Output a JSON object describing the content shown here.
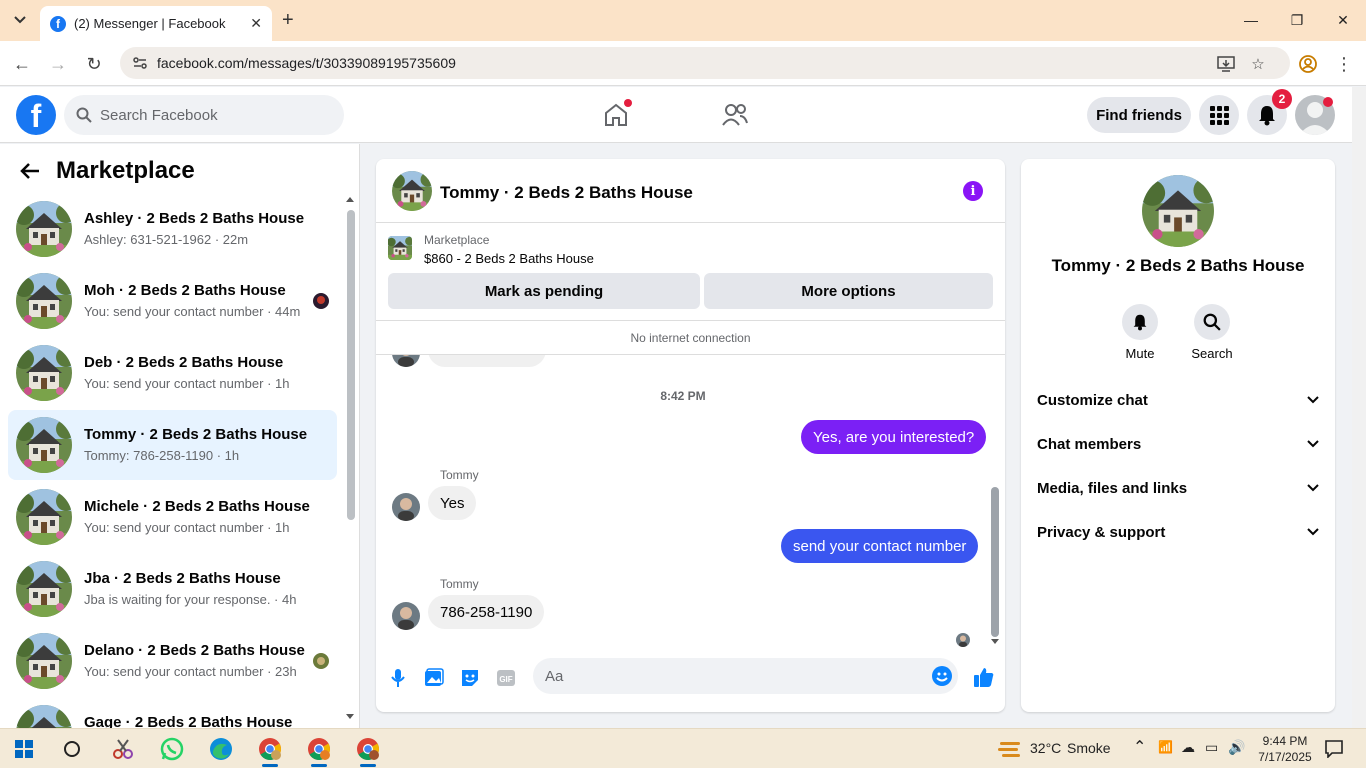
{
  "browser": {
    "tab_title": "(2) Messenger | Facebook",
    "url": "facebook.com/messages/t/30339089195735609"
  },
  "fb_header": {
    "search_placeholder": "Search Facebook",
    "find_friends": "Find friends",
    "notifications_badge": "2"
  },
  "sidebar": {
    "title": "Marketplace",
    "conversations": [
      {
        "name": "Ashley · 2 Beds 2 Baths House",
        "snippet": "Ashley: 631-521-1962 · 22m",
        "active": false
      },
      {
        "name": "Moh · 2 Beds 2 Baths House",
        "snippet": "You: send your contact number · 44m",
        "active": false
      },
      {
        "name": "Deb · 2 Beds 2 Baths House",
        "snippet": "You: send your contact number · 1h",
        "active": false
      },
      {
        "name": "Tommy · 2 Beds 2 Baths House",
        "snippet": "Tommy: 786-258-1190 · 1h",
        "active": true
      },
      {
        "name": "Michele · 2 Beds 2 Baths House",
        "snippet": "You: send your contact number · 1h",
        "active": false
      },
      {
        "name": "Jba · 2 Beds 2 Baths House",
        "snippet": "Jba is waiting for your response. · 4h",
        "active": false
      },
      {
        "name": "Delano · 2 Beds 2 Baths House",
        "snippet": "You: send your contact number · 23h",
        "active": false
      },
      {
        "name": "Gage · 2 Beds 2 Baths House",
        "snippet": "",
        "active": false
      }
    ]
  },
  "chat": {
    "title": "Tommy · 2 Beds 2 Baths House",
    "listing_label": "Marketplace",
    "listing_price": "$860 - 2 Beds 2 Baths House",
    "mark_pending": "Mark as pending",
    "more_options": "More options",
    "no_internet": "No internet connection",
    "timestamp": "8:42 PM",
    "messages": [
      {
        "from": "me",
        "text": "Yes, are you interested?"
      },
      {
        "from": "Tommy",
        "sender_label": "Tommy",
        "text": "Yes"
      },
      {
        "from": "me",
        "text": "send your contact number"
      },
      {
        "from": "Tommy",
        "sender_label": "Tommy",
        "text": "786-258-1190"
      }
    ],
    "composer_placeholder": "Aa"
  },
  "info_panel": {
    "name": "Tommy · 2 Beds 2 Baths House",
    "actions": [
      {
        "label": "Mute",
        "icon": "bell-icon"
      },
      {
        "label": "Search",
        "icon": "search-icon"
      }
    ],
    "sections": [
      "Customize chat",
      "Chat members",
      "Media, files and links",
      "Privacy & support"
    ]
  },
  "taskbar": {
    "weather_temp": "32°C",
    "weather_desc": "Smoke",
    "time": "9:44 PM",
    "date": "7/17/2025"
  },
  "colors": {
    "fb_blue": "#1877f2",
    "purple_bubble": "#7b20f5",
    "blue_bubble": "#3a56f0",
    "active_row": "#e7f3ff"
  }
}
